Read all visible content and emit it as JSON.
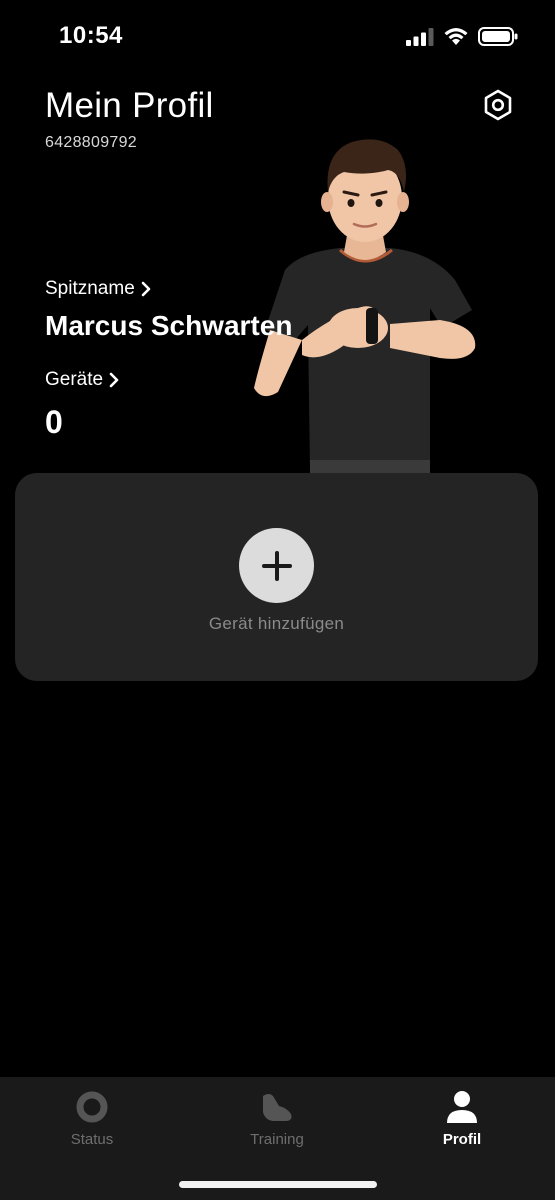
{
  "status_bar": {
    "time": "10:54"
  },
  "header": {
    "title": "Mein Profil",
    "user_id": "6428809792"
  },
  "profile": {
    "nickname_label": "Spitzname",
    "nickname": "Marcus Schwarten",
    "devices_label": "Geräte",
    "devices_count": "0"
  },
  "device_card": {
    "add_label": "Gerät hinzufügen"
  },
  "tabs": [
    {
      "label": "Status",
      "icon": "ring-icon",
      "active": false
    },
    {
      "label": "Training",
      "icon": "shoe-icon",
      "active": false
    },
    {
      "label": "Profil",
      "icon": "person-icon",
      "active": true
    }
  ],
  "colors": {
    "background": "#000000",
    "card": "#242424",
    "tab_bar": "#1a1a1a",
    "inactive": "#6e6e6e",
    "add_button": "#dcdcdc"
  }
}
